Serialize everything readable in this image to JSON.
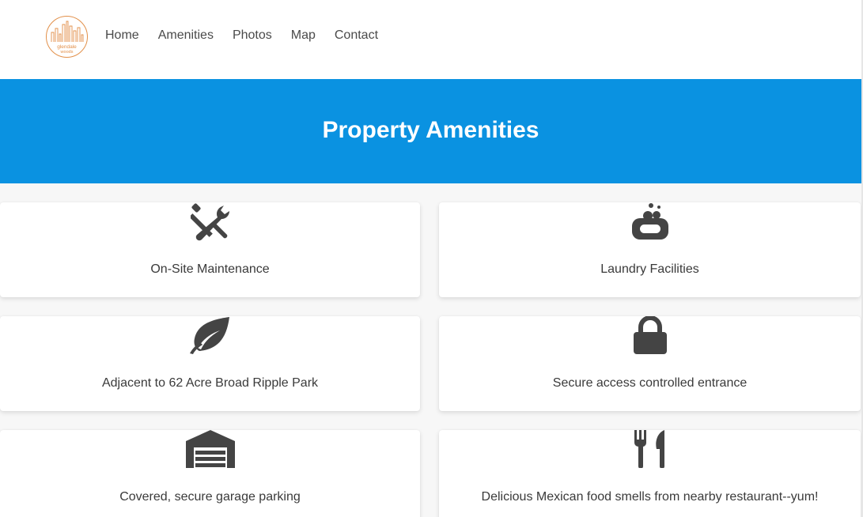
{
  "logo": {
    "line1": "glendale",
    "line2": "woods",
    "accent": "#e2904a"
  },
  "nav": {
    "items": [
      {
        "label": "Home"
      },
      {
        "label": "Amenities"
      },
      {
        "label": "Photos"
      },
      {
        "label": "Map"
      },
      {
        "label": "Contact"
      }
    ]
  },
  "hero": {
    "title": "Property Amenities",
    "background": "#0a92e1"
  },
  "amenities": [
    {
      "icon": "tools-icon",
      "label": "On-Site Maintenance"
    },
    {
      "icon": "soap-icon",
      "label": "Laundry Facilities"
    },
    {
      "icon": "leaf-icon",
      "label": "Adjacent to 62 Acre Broad Ripple Park"
    },
    {
      "icon": "lock-icon",
      "label": "Secure access controlled entrance"
    },
    {
      "icon": "garage-icon",
      "label": "Covered, secure garage parking"
    },
    {
      "icon": "utensils-icon",
      "label": "Delicious Mexican food smells from nearby restaurant--yum!"
    }
  ]
}
